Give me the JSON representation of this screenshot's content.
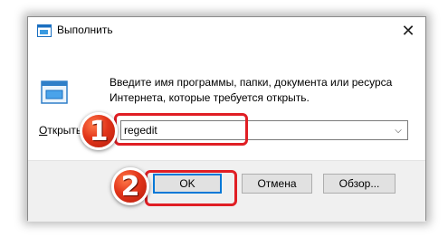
{
  "dialog": {
    "title": "Выполнить",
    "close_icon": "close-icon",
    "description": "Введите имя программы, папки, документа или ресурса Интернета, которые требуется открыть.",
    "open_label_first": "О",
    "open_label_rest": "ткрыть:",
    "input_value": "regedit",
    "buttons": {
      "ok": "OK",
      "cancel": "Отмена",
      "browse_first": "Обзор",
      "browse_rest": "..."
    }
  },
  "annotations": {
    "step1": "1",
    "step2": "2",
    "highlight_color": "#e01e24"
  }
}
